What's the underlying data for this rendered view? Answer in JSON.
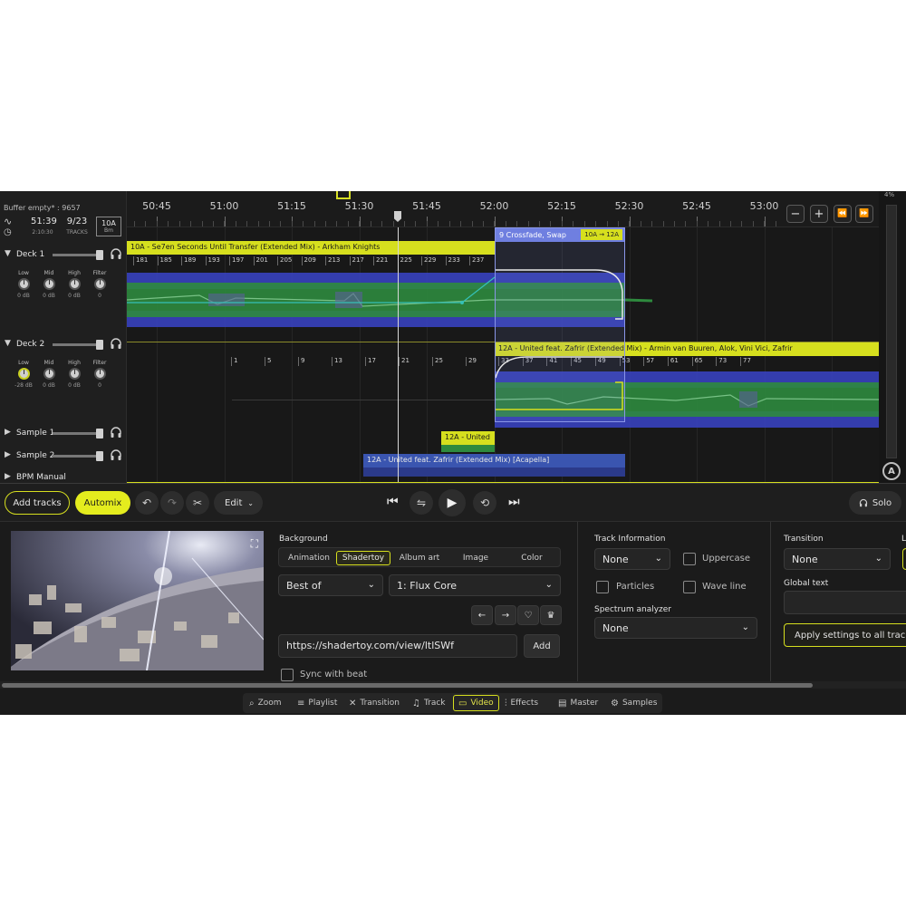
{
  "ruler": {
    "times": [
      "50:45",
      "51:00",
      "51:15",
      "51:30",
      "51:45",
      "52:00",
      "52:15",
      "52:30",
      "52:45",
      "53:00"
    ],
    "zoom_out_label": "−",
    "zoom_in_label": "+",
    "rewind_label": "⏪",
    "forward_label": "⏩"
  },
  "status": {
    "buffer": "Buffer empty* : 9657",
    "elapsed": "51:39",
    "elapsed_sub": "2:10:30",
    "tracks_count": "9/23",
    "tracks_sub": "TRACKS",
    "key": "10A",
    "key_sub": "Bm"
  },
  "decks": [
    {
      "name": "Deck 1",
      "knobs": [
        {
          "label": "Low",
          "value": "0 dB"
        },
        {
          "label": "Mid",
          "value": "0 dB"
        },
        {
          "label": "High",
          "value": "0 dB"
        },
        {
          "label": "Filter",
          "value": "0"
        }
      ]
    },
    {
      "name": "Deck 2",
      "knobs": [
        {
          "label": "Low",
          "value": "-28 dB"
        },
        {
          "label": "Mid",
          "value": "0 dB"
        },
        {
          "label": "High",
          "value": "0 dB"
        },
        {
          "label": "Filter",
          "value": "0"
        }
      ]
    }
  ],
  "samples": [
    "Sample 1",
    "Sample 2"
  ],
  "bpm_label": "BPM Manual",
  "tracks": {
    "deck1_title": "10A - Se7en Seconds Until Transfer (Extended Mix) - Arkham Knights",
    "deck1_beats": [
      "181",
      "185",
      "189",
      "193",
      "197",
      "201",
      "205",
      "209",
      "213",
      "217",
      "221",
      "225",
      "229",
      "233",
      "237"
    ],
    "deck2_title": "12A - United feat. Zafrir (Extended Mix) - Armin van Buuren, Alok, Vini Vici, Zafrir",
    "deck2_beats_left": [
      "1",
      "5",
      "9",
      "13",
      "17",
      "21",
      "25",
      "29"
    ],
    "deck2_beats_right": [
      "33",
      "37",
      "41",
      "45",
      "49",
      "53",
      "57",
      "61",
      "65",
      "73",
      "77"
    ],
    "sample1_title": "12A - United",
    "sample2_title": "12A - United feat. Zafrir (Extended Mix) [Acapella]",
    "crossfade_title": "9 Crossfade, Swap",
    "crossfade_key": "10A → 12A"
  },
  "meter": {
    "top_label": "4%",
    "logo": "A"
  },
  "transport": {
    "add_tracks": "Add tracks",
    "automix": "Automix",
    "edit": "Edit",
    "solo": "Solo"
  },
  "background": {
    "title": "Background",
    "tabs": [
      "Animation",
      "Shadertoy",
      "Album art",
      "Image",
      "Color"
    ],
    "active_tab": "Shadertoy",
    "category": "Best of",
    "shader": "1: Flux Core",
    "url": "https://shadertoy.com/view/ltlSWf",
    "add": "Add",
    "sync": "Sync with beat"
  },
  "track_info": {
    "title": "Track Information",
    "value": "None",
    "uppercase": "Uppercase",
    "particles": "Particles",
    "wave_line": "Wave line",
    "spectrum_title": "Spectrum analyzer",
    "spectrum_value": "None"
  },
  "transition": {
    "title": "Transition",
    "value": "None",
    "global_text": "Global text",
    "apply": "Apply settings to all tracks",
    "cut_label": "L"
  },
  "nav": [
    {
      "label": "Zoom",
      "icon": "⌕"
    },
    {
      "label": "Playlist",
      "icon": "≡"
    },
    {
      "label": "Transition",
      "icon": "✕"
    },
    {
      "label": "Track",
      "icon": "♫"
    },
    {
      "label": "Video",
      "icon": "▭"
    },
    {
      "label": "Effects",
      "icon": "⫶"
    },
    {
      "label": "Master",
      "icon": "▤"
    },
    {
      "label": "Samples",
      "icon": "⚙"
    }
  ],
  "colors": {
    "accent": "#d6df1e",
    "crossfade": "#6f7fe0",
    "wave_blue": "#3a44c8",
    "wave_green": "#2e8a3e"
  }
}
